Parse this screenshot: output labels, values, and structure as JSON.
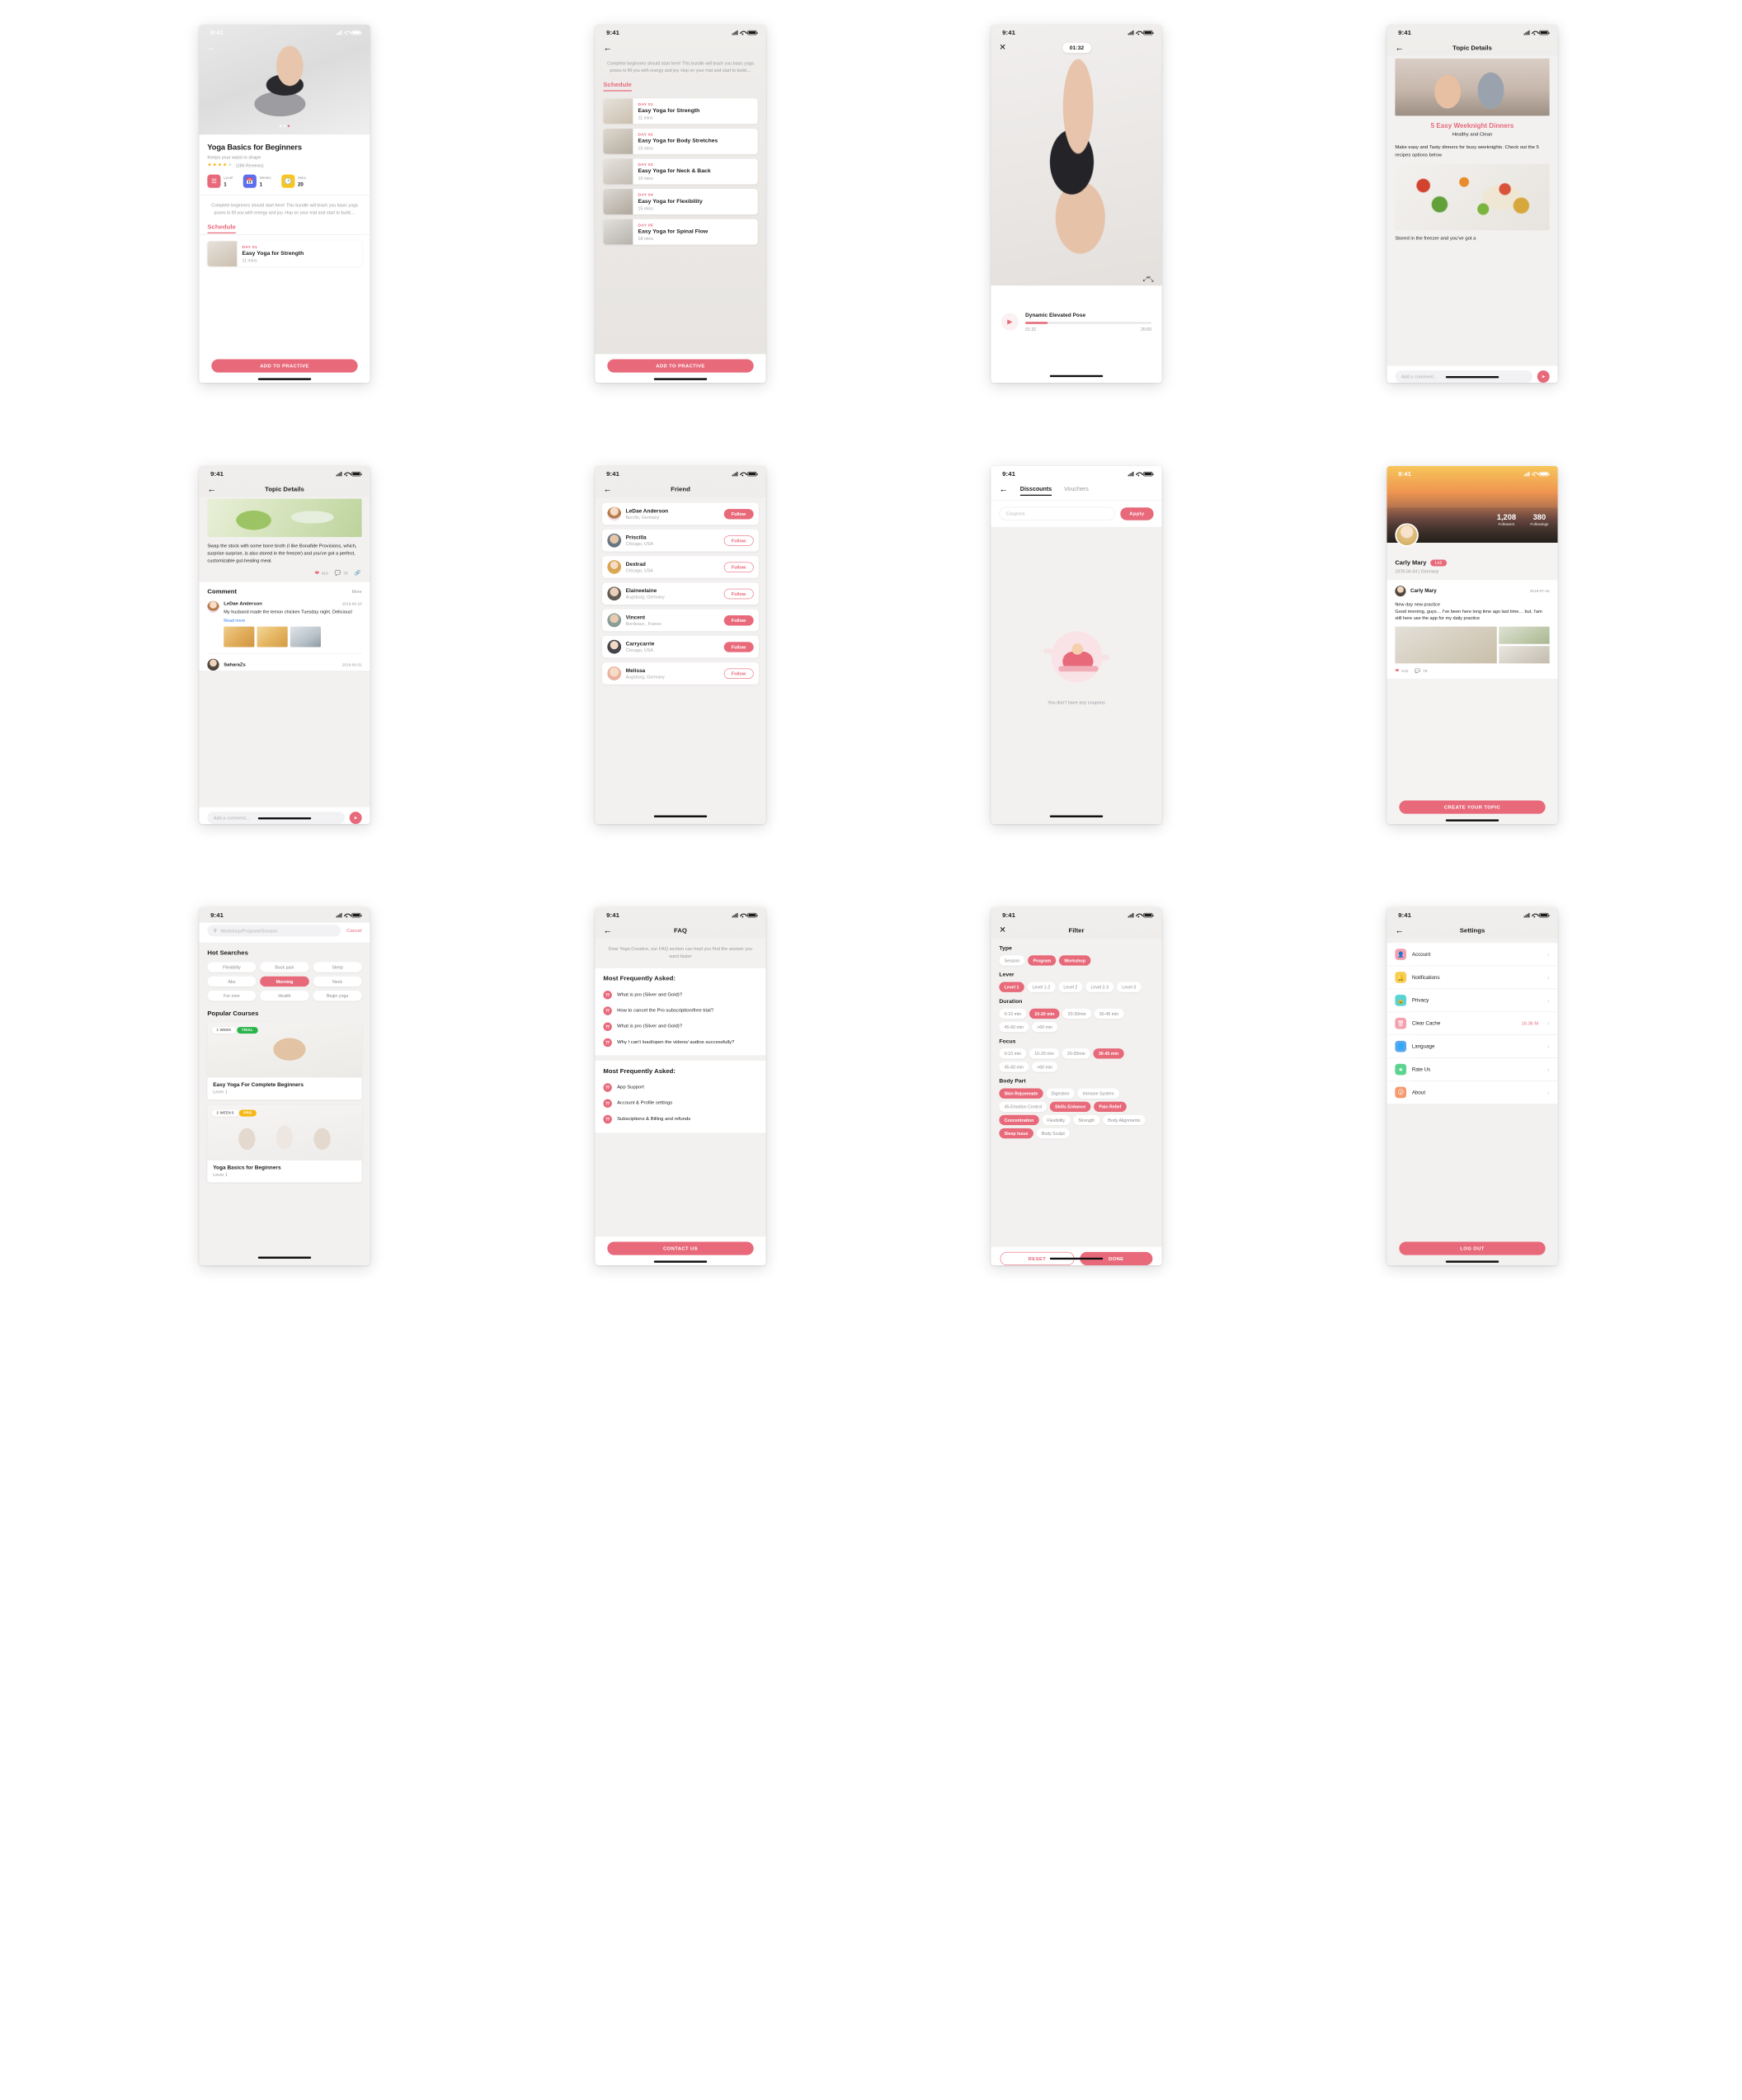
{
  "common": {
    "time": "9:41",
    "back_icon": "arrow-left-icon",
    "close_icon": "close-icon"
  },
  "screen1": {
    "title": "Yoga Basics for Beginners",
    "subtitle": "Keeps your waist in shape",
    "rating_filled": 4,
    "rating_total": 5,
    "reviews": "(286 Reviews)",
    "stats": [
      {
        "label": "Level",
        "value": "1",
        "icon": "level-icon",
        "color": "#e8697a"
      },
      {
        "label": "Weeks",
        "value": "1",
        "icon": "calendar-icon",
        "color": "#5b6ef0"
      },
      {
        "label": "Mins",
        "value": "20",
        "icon": "clock-icon",
        "color": "#f7c521"
      }
    ],
    "description": "Complete beginners should start here! This bundle will teach you basic yoga poses to fill you with energy and joy. Hop on your mat and start to build....",
    "schedule_label": "Schedule",
    "schedule": [
      {
        "day": "DAY 01",
        "title": "Easy Yoga for Strength",
        "mins": "11 mins"
      }
    ],
    "cta": "ADD TO PRACTIVE"
  },
  "screen2": {
    "description": "Complete beginners should start here! This bundle will teach you basic yoga poses to fill you with energy and joy. Hop on your mat and start to build....",
    "schedule_label": "Schedule",
    "schedule": [
      {
        "day": "DAY 01",
        "title": "Easy Yoga for Strength",
        "mins": "11 mins"
      },
      {
        "day": "DAY 02",
        "title": "Easy Yoga for Body Stretches",
        "mins": "15 mins"
      },
      {
        "day": "DAY 03",
        "title": "Easy Yoga for Neck & Back",
        "mins": "10 mins"
      },
      {
        "day": "DAY 04",
        "title": "Easy Yoga for Flexibility",
        "mins": "15 mins"
      },
      {
        "day": "DAY 05",
        "title": "Easy Yoga for Spinal Flow",
        "mins": "18 mins"
      }
    ],
    "cta": "ADD TO PRACTIVE"
  },
  "screen3": {
    "timer": "01:32",
    "fullscreen_icon": "fullscreen-icon",
    "play_icon": "play-icon",
    "video_title": "Dynamic Elevated Pose",
    "elapsed": "01:32",
    "total": "20:00",
    "progress_pct": 18
  },
  "screen4": {
    "nav_title": "Topic Details",
    "headline": "5 Easy Weeknight Dinners",
    "subhead": "Healthy and Clean",
    "body": "Make easy and Tasty dinners for busy weeknights. Check out the 5 recipes options below",
    "tail": "Stored in the freezer and you've got a",
    "comment_placeholder": "Add a comment...",
    "send_icon": "send-icon"
  },
  "screen5": {
    "nav_title": "Topic Details",
    "article": "Swap the stock with some bone broth (I like Bonafide Provisions, which, surprise surprise, is also stored in the freezer) and you've got a perfect, customizable gut-healing meal.",
    "likes": "410",
    "comments": "79",
    "like_icon": "heart-icon",
    "comment_icon": "comment-icon",
    "share_icon": "share-icon",
    "comment_header": "Comment",
    "more": "More",
    "comments_list": [
      {
        "name": "LeDae Anderson",
        "date": "2019-06-10",
        "text": "My husband made the lemon chicken Tuesday night. Delicious!",
        "read_more": "Read more",
        "images": 3
      },
      {
        "name": "SaharaZs",
        "date": "2019-06-01",
        "text": "",
        "read_more": "",
        "images": 0
      }
    ],
    "comment_placeholder": "Add a comment...",
    "send_icon": "send-icon"
  },
  "screen6": {
    "nav_title": "Friend",
    "friends": [
      {
        "name": "LeDae Anderson",
        "location": "Becrlin, Germany",
        "action": "Follow",
        "following": true
      },
      {
        "name": "Priscilla",
        "location": "Chicago, USA",
        "action": "Follow",
        "following": false
      },
      {
        "name": "Dextrad",
        "location": "Chicago, USA",
        "action": "Follow",
        "following": false
      },
      {
        "name": "Elaineelaine",
        "location": "Augsburg, Germany",
        "action": "Follow",
        "following": false
      },
      {
        "name": "Vincent",
        "location": "Bordeaux , France",
        "action": "Follow",
        "following": true
      },
      {
        "name": "Carrycarrie",
        "location": "Chicago, USA",
        "action": "Follow",
        "following": true
      },
      {
        "name": "Melissa",
        "location": "Augsburg, Germany",
        "action": "Follow",
        "following": false
      }
    ]
  },
  "screen7": {
    "tabs": [
      {
        "label": "Disscounts",
        "active": true
      },
      {
        "label": "Vouchers",
        "active": false
      }
    ],
    "coupon_placeholder": "Coupons",
    "apply": "Apply",
    "empty_text": "You don't have any coupons"
  },
  "screen8": {
    "followers_count": "1,208",
    "followers_label": "Followers",
    "followings_count": "380",
    "followings_label": "Followings",
    "name": "Carly Mary",
    "level": "Lv2",
    "meta": "1978-04-04  |  Germany",
    "post_author": "Carly Mary",
    "post_date": "2019-07-16",
    "post_text": "New day new practice\nGood morning, guys… I've been here long time ago last time… but, I'am still here use the app for my daily practice",
    "likes": "410",
    "comments": "79",
    "cta": "CREATE YOUR TOPIC"
  },
  "screen9": {
    "search_placeholder": "Workshop/Program/Session",
    "search_icon": "search-icon",
    "cancel": "Cancel",
    "hot_title": "Hot Searches",
    "hot_tags": [
      {
        "label": "Flexibility",
        "active": false
      },
      {
        "label": "Back pain",
        "active": false
      },
      {
        "label": "Sleep",
        "active": false
      },
      {
        "label": "Abs",
        "active": false
      },
      {
        "label": "Morning",
        "active": true
      },
      {
        "label": "Neck",
        "active": false
      },
      {
        "label": "For men",
        "active": false
      },
      {
        "label": "Health",
        "active": false
      },
      {
        "label": "Begin yoga",
        "active": false
      }
    ],
    "popular_title": "Popular Courses",
    "courses": [
      {
        "weeks": "1 WEEK",
        "tag": "TRIAL",
        "tag_kind": "trial",
        "title": "Easy Yoga For Complete Beginners",
        "level": "Lever 1"
      },
      {
        "weeks": "2 WEEKS",
        "tag": "PRO",
        "tag_kind": "pro",
        "title": "Yoga Basics for Beginners",
        "level": "Lever 1"
      }
    ]
  },
  "screen10": {
    "nav_title": "FAQ",
    "intro": "Dear Yoga Creative, our FAQ section can hepl you find the answer you want faster",
    "group1_title": "Most Frequently Asked:",
    "group1": [
      "What is pro (Sliver and Gold)?",
      "How to cancel the Pro subscription/free trial?",
      "What is pro (Sliver and Gold)?",
      "Why I can't load/open the videos/ audios successfully?"
    ],
    "group2_title": "Most Frequently Asked:",
    "group2": [
      "App Support",
      "Account & Profile settings",
      "Subsciptions & Billing and refunds"
    ],
    "cta": "CONTACT US"
  },
  "screen11": {
    "nav_title": "Filter",
    "groups": [
      {
        "title": "Type",
        "options": [
          {
            "label": "Session",
            "active": false
          },
          {
            "label": "Program",
            "active": true
          },
          {
            "label": "Workshop",
            "active": true
          }
        ]
      },
      {
        "title": "Lever",
        "options": [
          {
            "label": "Level 1",
            "active": true
          },
          {
            "label": "Level 1-2",
            "active": false
          },
          {
            "label": "Level 2",
            "active": false
          },
          {
            "label": "Level 2-3",
            "active": false
          },
          {
            "label": "Level 3",
            "active": false
          }
        ]
      },
      {
        "title": "Duration",
        "options": [
          {
            "label": "0-10 min",
            "active": false
          },
          {
            "label": "10-20 min",
            "active": true
          },
          {
            "label": "20-30min",
            "active": false
          },
          {
            "label": "30-45 min",
            "active": false
          },
          {
            "label": "45-60 min",
            "active": false
          },
          {
            "label": ">60 min",
            "active": false
          }
        ]
      },
      {
        "title": "Focus",
        "options": [
          {
            "label": "0-10 min",
            "active": false
          },
          {
            "label": "10-20 min",
            "active": false
          },
          {
            "label": "20-30min",
            "active": false
          },
          {
            "label": "30-45 min",
            "active": true
          },
          {
            "label": "45-60 min",
            "active": false
          },
          {
            "label": ">60 min",
            "active": false
          }
        ]
      },
      {
        "title": "Body Part",
        "options": [
          {
            "label": "Skin Rejuvenate",
            "active": true
          },
          {
            "label": "Digestion",
            "active": false
          },
          {
            "label": "Immune System",
            "active": false
          },
          {
            "label": "45-Emotion Control",
            "active": false
          },
          {
            "label": "Skills Enhance",
            "active": true
          },
          {
            "label": "Pain Relief",
            "active": true
          },
          {
            "label": "Concentration",
            "active": true
          },
          {
            "label": "Flexibility",
            "active": false
          },
          {
            "label": "Strength",
            "active": false
          },
          {
            "label": "Body Alignments",
            "active": false
          },
          {
            "label": "Sleep Issue",
            "active": true
          },
          {
            "label": "Body Sculpt",
            "active": false
          }
        ]
      }
    ],
    "reset": "RESET",
    "done": "DONE"
  },
  "screen12": {
    "nav_title": "Settings",
    "items": [
      {
        "label": "Account",
        "icon": "account-icon",
        "color": "#f4a0ae",
        "value": ""
      },
      {
        "label": "Notifications",
        "icon": "bell-icon",
        "color": "#f7ce55",
        "value": ""
      },
      {
        "label": "Privacy",
        "icon": "lock-icon",
        "color": "#57d4d4",
        "value": ""
      },
      {
        "label": "Clear Cache",
        "icon": "trash-icon",
        "color": "#f4a0ae",
        "value": "16.36 M"
      },
      {
        "label": "Language",
        "icon": "globe-icon",
        "color": "#5aa7f0",
        "value": ""
      },
      {
        "label": "Rate Us",
        "icon": "star-icon",
        "color": "#5ad48f",
        "value": ""
      },
      {
        "label": "About",
        "icon": "info-icon",
        "color": "#f49a6e",
        "value": ""
      }
    ],
    "cta": "LOG OUT"
  }
}
